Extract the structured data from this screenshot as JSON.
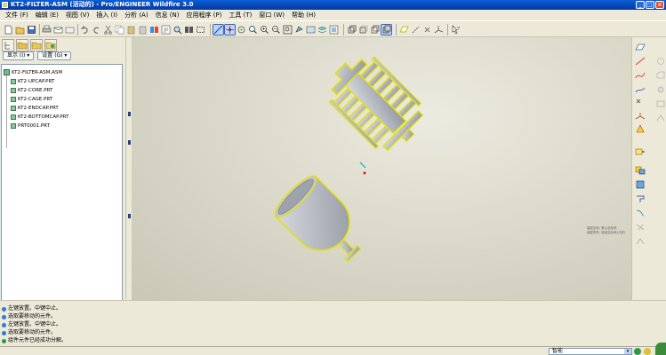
{
  "window": {
    "title": "KT2-FILTER-ASM (活动的) - Pro/ENGINEER Wildfire 3.0",
    "minimize": "_",
    "maximize": "□",
    "close": "×"
  },
  "menu": [
    "文件 (F)",
    "编辑 (E)",
    "视图 (V)",
    "插入 (I)",
    "分析 (A)",
    "信息 (N)",
    "应用程序 (P)",
    "工具 (T)",
    "窗口 (W)",
    "帮助 (H)"
  ],
  "model_tree": {
    "show_label": "显示 (I) ▾",
    "settings_label": "设置 (G) ▾",
    "root": "KT2-FILTER-ASM.ASM",
    "items": [
      "KT2-UPCAP.PRT",
      "KT2-CORE.PRT",
      "KT2-CAGE.PRT",
      "KT2-ENDCAP.PRT",
      "KT2-BOTTOMCAP.PRT",
      "PRT0001.PRT"
    ]
  },
  "viewport": {
    "background_color": "#dcdacb",
    "datum_lines": [
      "装配坐标: 默认坐标系",
      "装配零件: 缺省坐标系(元件)"
    ]
  },
  "messages": [
    "左键放置。中键中止。",
    "选取要移动的元件。",
    "左键放置。中键中止。",
    "选取要移动的元件。",
    "组件元件已经成功分解。"
  ],
  "status": {
    "filter_value": "智能",
    "filter_arrow": "▾"
  },
  "colors": {
    "title_bar": "#0846b4",
    "highlight_edge": "#e6e200",
    "model_shade": "#b8bcc4"
  }
}
